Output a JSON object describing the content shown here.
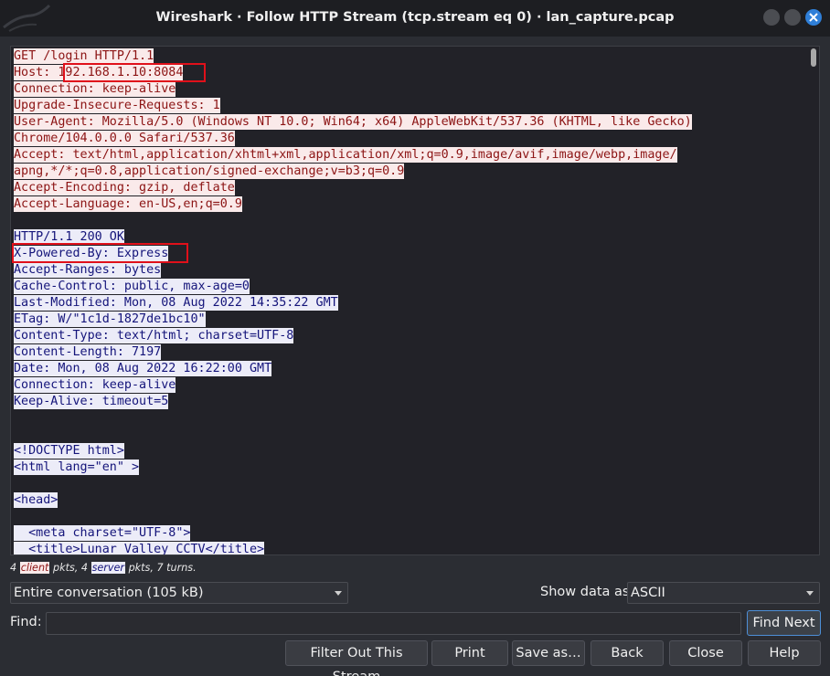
{
  "window": {
    "title": "Wireshark · Follow HTTP Stream (tcp.stream eq 0) · lan_capture.pcap"
  },
  "stream": {
    "lines": [
      {
        "dir": "client",
        "text": "GET /login HTTP/1.1"
      },
      {
        "dir": "client",
        "text": "Host: 192.168.1.10:8084"
      },
      {
        "dir": "client",
        "text": "Connection: keep-alive"
      },
      {
        "dir": "client",
        "text": "Upgrade-Insecure-Requests: 1"
      },
      {
        "dir": "client",
        "text": "User-Agent: Mozilla/5.0 (Windows NT 10.0; Win64; x64) AppleWebKit/537.36 (KHTML, like Gecko)"
      },
      {
        "dir": "client",
        "text": "Chrome/104.0.0.0 Safari/537.36"
      },
      {
        "dir": "client",
        "text": "Accept: text/html,application/xhtml+xml,application/xml;q=0.9,image/avif,image/webp,image/"
      },
      {
        "dir": "client",
        "text": "apng,*/*;q=0.8,application/signed-exchange;v=b3;q=0.9"
      },
      {
        "dir": "client",
        "text": "Accept-Encoding: gzip, deflate"
      },
      {
        "dir": "client",
        "text": "Accept-Language: en-US,en;q=0.9"
      },
      {
        "dir": "blank",
        "text": ""
      },
      {
        "dir": "server",
        "text": "HTTP/1.1 200 OK"
      },
      {
        "dir": "server",
        "text": "X-Powered-By: Express"
      },
      {
        "dir": "server",
        "text": "Accept-Ranges: bytes"
      },
      {
        "dir": "server",
        "text": "Cache-Control: public, max-age=0"
      },
      {
        "dir": "server",
        "text": "Last-Modified: Mon, 08 Aug 2022 14:35:22 GMT"
      },
      {
        "dir": "server",
        "text": "ETag: W/\"1c1d-1827de1bc10\""
      },
      {
        "dir": "server",
        "text": "Content-Type: text/html; charset=UTF-8"
      },
      {
        "dir": "server",
        "text": "Content-Length: 7197"
      },
      {
        "dir": "server",
        "text": "Date: Mon, 08 Aug 2022 16:22:00 GMT"
      },
      {
        "dir": "server",
        "text": "Connection: keep-alive"
      },
      {
        "dir": "server",
        "text": "Keep-Alive: timeout=5"
      },
      {
        "dir": "blank",
        "text": ""
      },
      {
        "dir": "blank",
        "text": ""
      },
      {
        "dir": "server",
        "text": "<!DOCTYPE html>"
      },
      {
        "dir": "server",
        "text": "<html lang=\"en\" >"
      },
      {
        "dir": "blank",
        "text": ""
      },
      {
        "dir": "server",
        "text": "<head>"
      },
      {
        "dir": "blank",
        "text": ""
      },
      {
        "dir": "server",
        "text": "  <meta charset=\"UTF-8\">"
      },
      {
        "dir": "server",
        "text": "  <title>Lunar Valley CCTV</title>"
      }
    ]
  },
  "stats": {
    "client_count": "4",
    "client_label": "client",
    "pkts_sep": "pkts, 4",
    "server_label": "server",
    "tail": "pkts, 7 turns."
  },
  "controls": {
    "conversation_select": "Entire conversation (105 kB)",
    "show_data_label": "Show data as",
    "format_select": "ASCII",
    "find_label": "Find:",
    "find_value": "",
    "find_next_label": "Find Next"
  },
  "buttons": {
    "filter_out": "Filter Out This Stream",
    "print": "Print",
    "save_as": "Save as…",
    "back": "Back",
    "close": "Close",
    "help": "Help"
  },
  "colors": {
    "client_fg": "#8c1414",
    "client_bg": "#faeaea",
    "server_fg": "#14147a",
    "server_bg": "#ececf8",
    "highlight_box": "#e0101a"
  }
}
